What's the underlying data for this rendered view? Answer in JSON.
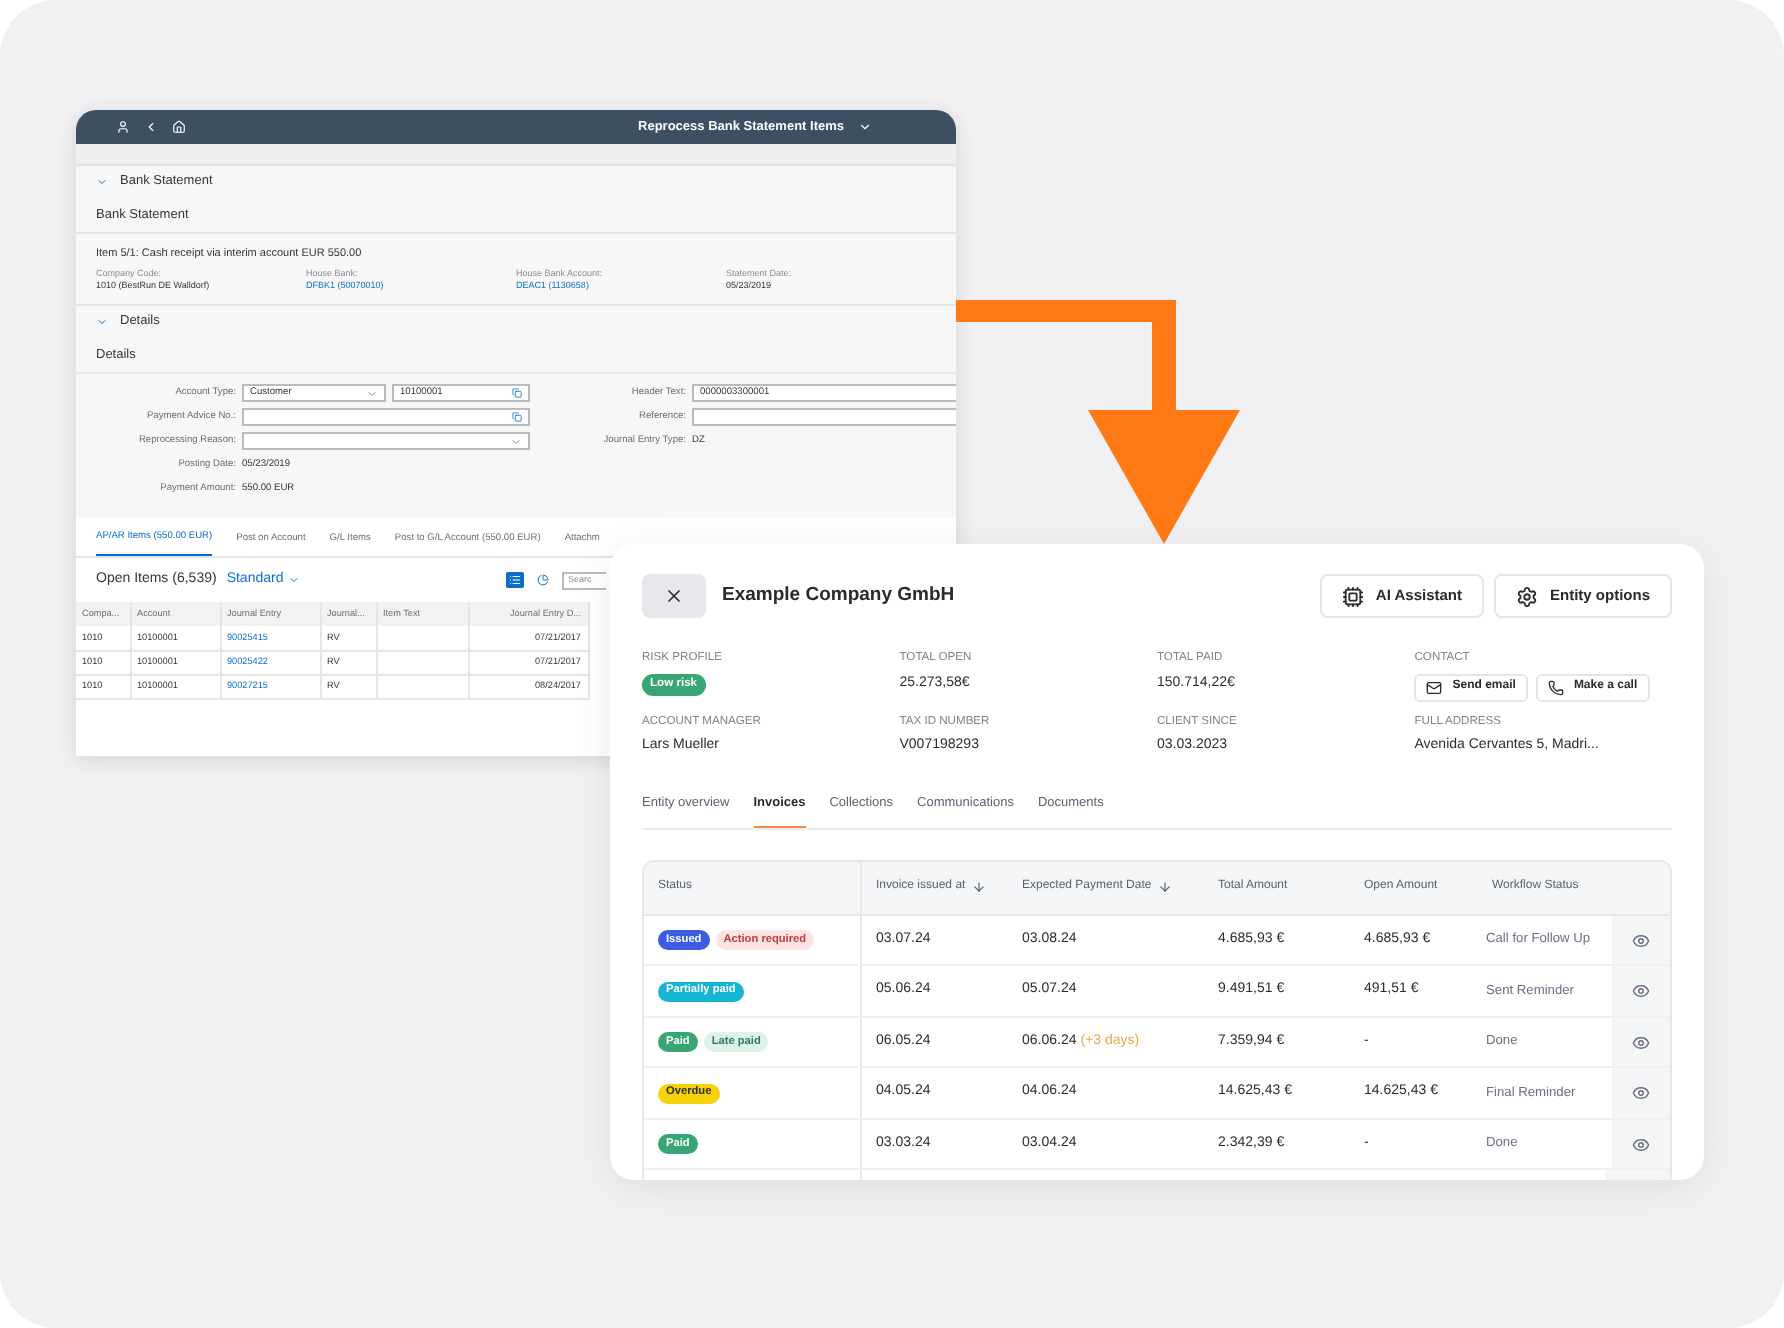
{
  "background_window": {
    "title": "Reprocess Bank Statement Items",
    "bank_statement": {
      "heading": "Bank Statement",
      "expanded": true,
      "title": "Bank Statement",
      "item_line": "Item 5/1: Cash receipt via interim account EUR 550.00",
      "fields": [
        {
          "label": "Company Code:",
          "value": "1010 (BestRun DE Walldorf)",
          "kind": "text"
        },
        {
          "label": "House Bank:",
          "value": "DFBK1 (50070010)",
          "kind": "link"
        },
        {
          "label": "House Bank Account:",
          "value": "DEAC1 (1130658)",
          "kind": "link"
        },
        {
          "label": "Statement Date:",
          "value": "05/23/2019",
          "kind": "text"
        }
      ]
    },
    "details": {
      "heading": "Details",
      "expanded": true,
      "title": "Details",
      "form_left": [
        {
          "label": "Account Type:",
          "kind": "select_input",
          "value": "Customer",
          "value_2": "10100001"
        },
        {
          "label": "Payment Advice No.:",
          "kind": "input_help"
        },
        {
          "label": "Reprocessing Reason:",
          "kind": "select"
        },
        {
          "label": "Posting Date:",
          "kind": "text",
          "value": "05/23/2019"
        },
        {
          "label": "Payment Amount:",
          "kind": "text",
          "value": "550.00  EUR"
        }
      ],
      "form_right": [
        {
          "label": "Header Text:",
          "kind": "input",
          "value": "0000003300001"
        },
        {
          "label": "Reference:",
          "kind": "input"
        },
        {
          "label": "Journal Entry Type:",
          "kind": "text",
          "value": "DZ"
        }
      ]
    },
    "tabs": [
      {
        "label": "AP/AR Items (550.00 EUR)",
        "selected": true
      },
      {
        "label": "Post on Account",
        "selected": false
      },
      {
        "label": "G/L Items",
        "selected": false
      },
      {
        "label": "Post to G/L Account (550.00 EUR)",
        "selected": false
      },
      {
        "label": "Attachm",
        "selected": false
      }
    ],
    "open_items": {
      "title": "Open Items (6,539)",
      "variant": "Standard",
      "search_placeholder": "Searc"
    },
    "table": {
      "columns": [
        {
          "label": "Compa...",
          "kind": "text"
        },
        {
          "label": "Account",
          "kind": "text"
        },
        {
          "label": "Journal Entry",
          "kind": "link"
        },
        {
          "label": "Journal...",
          "kind": "text"
        },
        {
          "label": "Item Text",
          "kind": "text"
        },
        {
          "label": "Journal Entry D...",
          "kind": "date"
        }
      ],
      "rows": [
        [
          "1010",
          "10100001",
          "90025415",
          "RV",
          "",
          "07/21/2017"
        ],
        [
          "1010",
          "10100001",
          "90025422",
          "RV",
          "",
          "07/21/2017"
        ],
        [
          "1010",
          "10100001",
          "90027215",
          "RV",
          "",
          "08/24/2017"
        ]
      ]
    }
  },
  "entity_card": {
    "title": "Example Company GmbH",
    "actions": [
      {
        "label": "AI Assistant",
        "kind": "ai"
      },
      {
        "label": "Entity options",
        "kind": "settings"
      }
    ],
    "info": [
      {
        "label": "RISK PROFILE",
        "kind": "badge",
        "value": "Low risk"
      },
      {
        "label": "TOTAL OPEN",
        "kind": "text",
        "value": "25.273,58€"
      },
      {
        "label": "TOTAL PAID",
        "kind": "text",
        "value": "150.714,22€"
      },
      {
        "label": "CONTACT",
        "kind": "buttons",
        "buttons": [
          {
            "label": "Send email",
            "kind": "email"
          },
          {
            "label": "Make a call",
            "kind": "phone"
          }
        ]
      },
      {
        "label": "ACCOUNT MANAGER",
        "kind": "text",
        "value": "Lars Mueller"
      },
      {
        "label": "TAX ID NUMBER",
        "kind": "text",
        "value": "V007198293"
      },
      {
        "label": "CLIENT SINCE",
        "kind": "text",
        "value": "03.03.2023"
      },
      {
        "label": "FULL ADDRESS",
        "kind": "text",
        "value": "Avenida Cervantes 5, Madri..."
      }
    ],
    "tabs": [
      {
        "label": "Entity overview",
        "selected": false
      },
      {
        "label": "Invoices",
        "selected": true
      },
      {
        "label": "Collections",
        "selected": false
      },
      {
        "label": "Communications",
        "selected": false
      },
      {
        "label": "Documents",
        "selected": false
      }
    ],
    "columns": [
      {
        "label": "Status",
        "sortable": false
      },
      {
        "label": "Invoice issued at",
        "sortable": true
      },
      {
        "label": "Expected Payment Date",
        "sortable": true
      },
      {
        "label": "Total Amount",
        "sortable": false
      },
      {
        "label": "Open Amount",
        "sortable": false
      },
      {
        "label": "Workflow Status",
        "sortable": false
      }
    ],
    "rows": [
      {
        "badges": [
          {
            "label": "Issued",
            "kind": "issued"
          },
          {
            "label": "Action required",
            "kind": "action"
          }
        ],
        "issued": "03.07.24",
        "expected": "03.08.24",
        "total": "4.685,93 €",
        "open": "4.685,93 €",
        "workflow": "Call for Follow Up"
      },
      {
        "badges": [
          {
            "label": "Partially paid",
            "kind": "partial"
          }
        ],
        "issued": "05.06.24",
        "expected": "05.07.24",
        "total": "9.491,51 €",
        "open": "491,51 €",
        "workflow": "Sent Reminder"
      },
      {
        "badges": [
          {
            "label": "Paid",
            "kind": "paid"
          },
          {
            "label": "Late paid",
            "kind": "late"
          }
        ],
        "issued": "06.05.24",
        "expected": "06.06.24",
        "expected_note": "(+3 days)",
        "total": "7.359,94 €",
        "open": "-",
        "workflow": "Done"
      },
      {
        "badges": [
          {
            "label": "Overdue",
            "kind": "overdue"
          }
        ],
        "issued": "04.05.24",
        "expected": "04.06.24",
        "total": "14.625,43 €",
        "open": "14.625,43 €",
        "workflow": "Final Reminder"
      },
      {
        "badges": [
          {
            "label": "Paid",
            "kind": "paid"
          }
        ],
        "issued": "03.03.24",
        "expected": "03.04.24",
        "total": "2.342,39 €",
        "open": "-",
        "workflow": "Done"
      }
    ]
  }
}
